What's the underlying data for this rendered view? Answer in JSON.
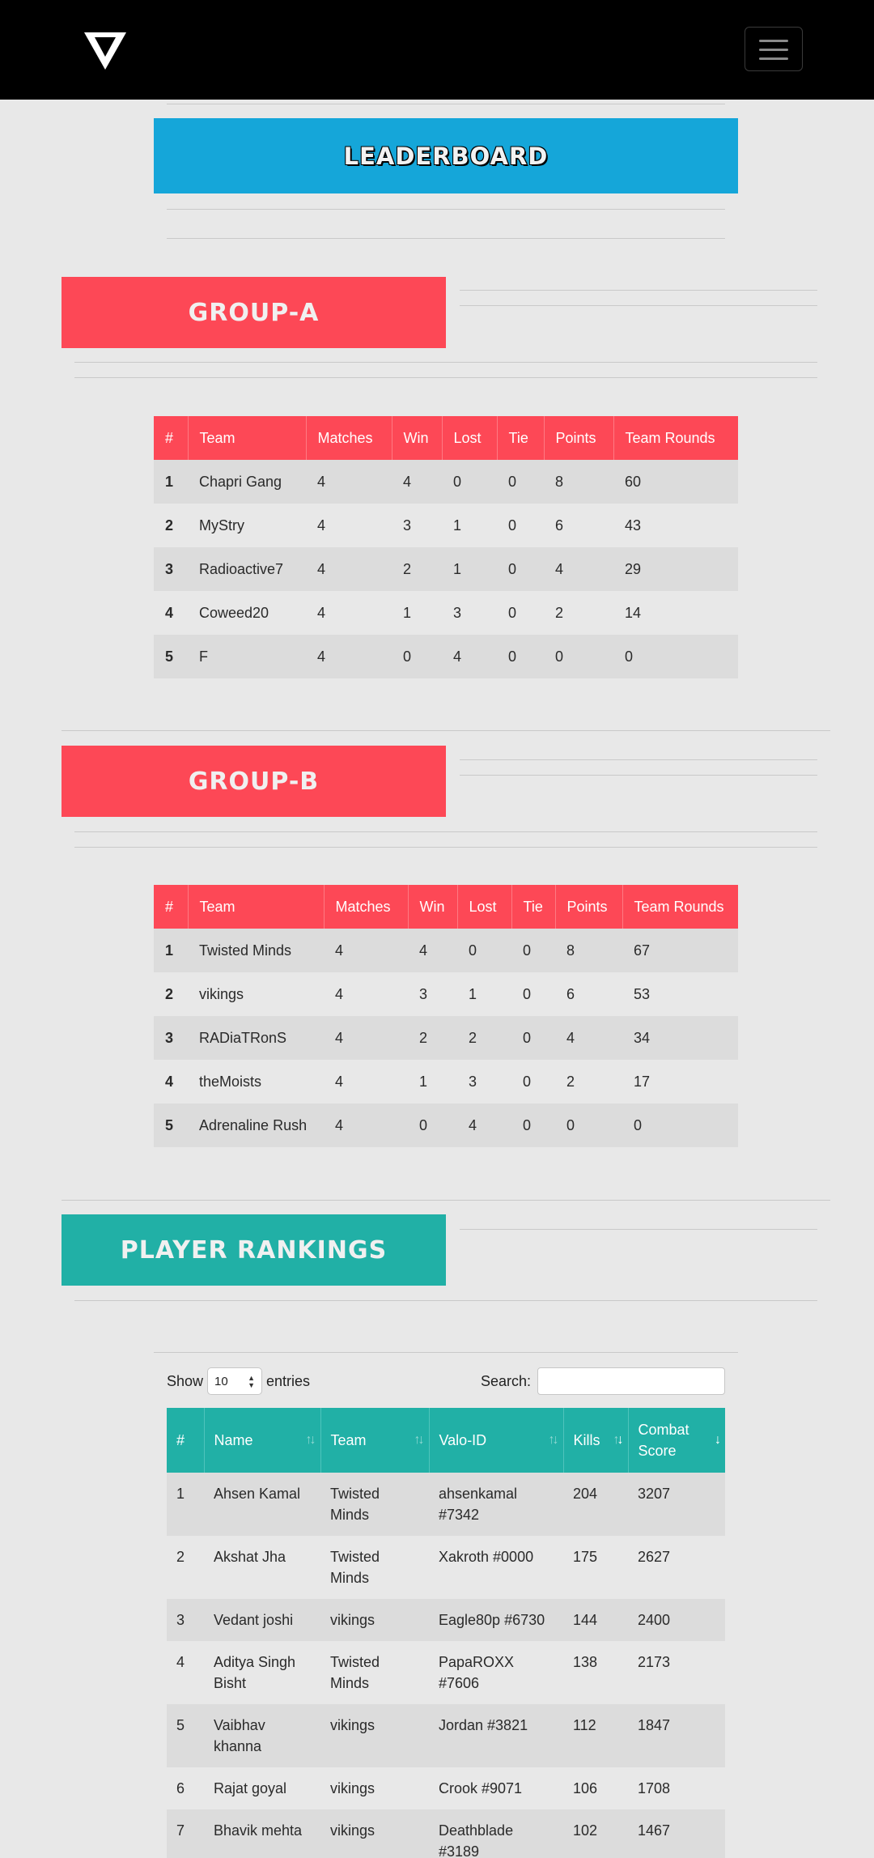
{
  "nav": {
    "logo_icon": "v-logo-icon",
    "menu_icon": "hamburger-icon"
  },
  "leaderboard": {
    "title": "LEADERBOARD"
  },
  "group_a": {
    "title": "GROUP-A",
    "headers": [
      "#",
      "Team",
      "Matches",
      "Win",
      "Lost",
      "Tie",
      "Points",
      "Team Rounds"
    ],
    "rows": [
      [
        "1",
        "Chapri Gang",
        "4",
        "4",
        "0",
        "0",
        "8",
        "60"
      ],
      [
        "2",
        "MyStry",
        "4",
        "3",
        "1",
        "0",
        "6",
        "43"
      ],
      [
        "3",
        "Radioactive7",
        "4",
        "2",
        "1",
        "0",
        "4",
        "29"
      ],
      [
        "4",
        "Coweed20",
        "4",
        "1",
        "3",
        "0",
        "2",
        "14"
      ],
      [
        "5",
        "F",
        "4",
        "0",
        "4",
        "0",
        "0",
        "0"
      ]
    ]
  },
  "group_b": {
    "title": "GROUP-B",
    "headers": [
      "#",
      "Team",
      "Matches",
      "Win",
      "Lost",
      "Tie",
      "Points",
      "Team Rounds"
    ],
    "rows": [
      [
        "1",
        "Twisted Minds",
        "4",
        "4",
        "0",
        "0",
        "8",
        "67"
      ],
      [
        "2",
        "vikings",
        "4",
        "3",
        "1",
        "0",
        "6",
        "53"
      ],
      [
        "3",
        "RADiaTRonS",
        "4",
        "2",
        "2",
        "0",
        "4",
        "34"
      ],
      [
        "4",
        "theMoists",
        "4",
        "1",
        "3",
        "0",
        "2",
        "17"
      ],
      [
        "5",
        "Adrenaline Rush",
        "4",
        "0",
        "4",
        "0",
        "0",
        "0"
      ]
    ]
  },
  "player_rankings": {
    "title": "PLAYER RANKINGS",
    "show_label": "Show",
    "entries_label": "entries",
    "length_value": "10",
    "search_label": "Search:",
    "search_value": "",
    "headers": [
      "#",
      "Name",
      "Team",
      "Valo-ID",
      "Kills",
      "Combat Score"
    ],
    "rows": [
      [
        "1",
        "Ahsen Kamal",
        "Twisted Minds",
        "ahsenkamal #7342",
        "204",
        "3207"
      ],
      [
        "2",
        "Akshat Jha",
        "Twisted Minds",
        "Xakroth #0000",
        "175",
        "2627"
      ],
      [
        "3",
        "Vedant joshi",
        "vikings",
        "Eagle80p #6730",
        "144",
        "2400"
      ],
      [
        "4",
        "Aditya Singh Bisht",
        "Twisted Minds",
        "PapaROXX #7606",
        "138",
        "2173"
      ],
      [
        "5",
        "Vaibhav khanna",
        "vikings",
        "Jordan #3821",
        "112",
        "1847"
      ],
      [
        "6",
        "Rajat goyal",
        "vikings",
        "Crook #9071",
        "106",
        "1708"
      ],
      [
        "7",
        "Bhavik mehta",
        "vikings",
        "Deathblade #3189",
        "102",
        "1467"
      ]
    ]
  }
}
